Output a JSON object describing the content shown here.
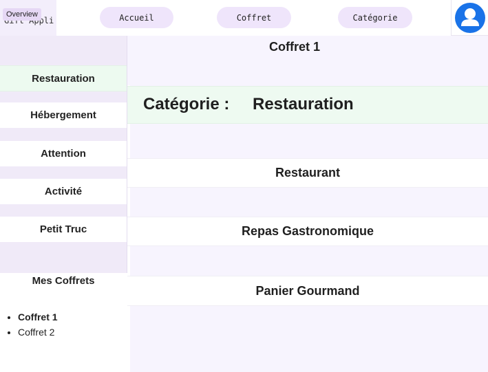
{
  "app": {
    "name": "Gift Appli",
    "badge": "Overview"
  },
  "nav": {
    "accueil": "Accueil",
    "coffret": "Coffret",
    "categorie": "Catégorie"
  },
  "user": {
    "avatar_icon": "user-avatar-icon",
    "avatar_color": "#1a73e8"
  },
  "sidebar": {
    "categories": [
      {
        "label": "Restauration"
      },
      {
        "label": "Hébergement"
      },
      {
        "label": "Attention"
      },
      {
        "label": "Activité"
      },
      {
        "label": "Petit Truc"
      }
    ],
    "my_boxes_title": "Mes Coffrets",
    "my_boxes": [
      {
        "label": "Coffret 1"
      },
      {
        "label": "Coffret 2"
      }
    ]
  },
  "main": {
    "coffret_title": "Coffret 1",
    "category_label": "Catégorie :",
    "category_value": "Restauration",
    "products": [
      {
        "label": "Restaurant"
      },
      {
        "label": "Repas Gastronomique"
      },
      {
        "label": "Panier Gourmand"
      }
    ]
  }
}
